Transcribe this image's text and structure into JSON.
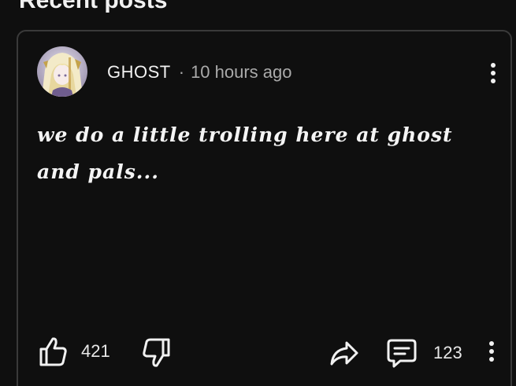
{
  "section": {
    "title": "Recent posts"
  },
  "post": {
    "author": "GHOST",
    "separator": "·",
    "time": "10 hours ago",
    "text": "we do a little trolling here at ghost and pals...",
    "likes": "421",
    "comments": "123"
  },
  "icons": {
    "menu_top": "more-vertical-icon",
    "like": "thumbs-up-icon",
    "dislike": "thumbs-down-icon",
    "share": "share-arrow-icon",
    "comment": "comment-icon",
    "menu_bottom": "more-vertical-icon"
  },
  "colors": {
    "background": "#0f0f0f",
    "card_border": "#3a3a3a",
    "text_primary": "#f1f1f1",
    "text_secondary": "#aaaaaa"
  }
}
